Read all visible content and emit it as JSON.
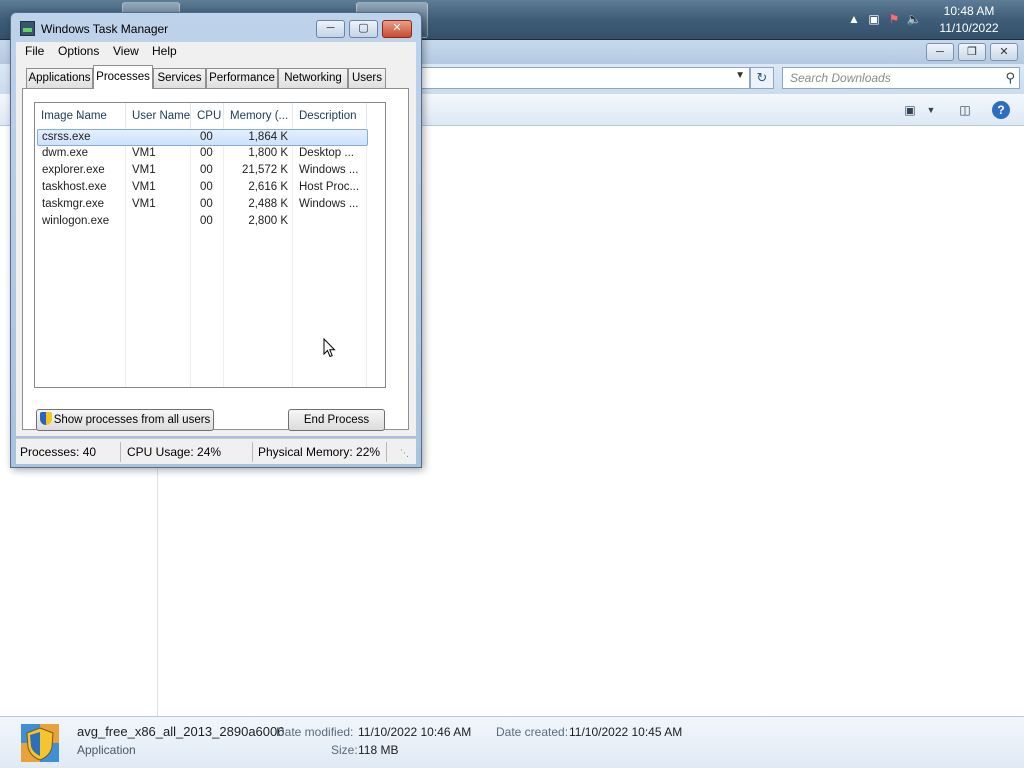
{
  "taskbar": {
    "clock_time": "10:48 AM",
    "clock_date": "11/10/2022",
    "tray_icons": [
      "show-hidden-icons-arrow",
      "network-icon",
      "action-center-icon",
      "volume-icon"
    ]
  },
  "explorer": {
    "search_placeholder": "Search Downloads",
    "caption_buttons": [
      "minimize",
      "maximize",
      "close"
    ],
    "details": {
      "file_name": "avg_free_x86_all_2013_2890a6006",
      "file_type": "Application",
      "date_modified_label": "Date modified:",
      "date_modified": "11/10/2022 10:46 AM",
      "date_created_label": "Date created:",
      "date_created": "11/10/2022 10:45 AM",
      "size_label": "Size:",
      "size": "118 MB"
    }
  },
  "taskmanager": {
    "title": "Windows Task Manager",
    "menu": [
      "File",
      "Options",
      "View",
      "Help"
    ],
    "tabs": [
      "Applications",
      "Processes",
      "Services",
      "Performance",
      "Networking",
      "Users"
    ],
    "active_tab": "Processes",
    "columns": [
      "Image Name",
      "User Name",
      "CPU",
      "Memory (...",
      "Description"
    ],
    "rows": [
      {
        "image": "csrss.exe",
        "user": "",
        "cpu": "00",
        "memory": "1,864 K",
        "desc": "",
        "selected": true
      },
      {
        "image": "dwm.exe",
        "user": "VM1",
        "cpu": "00",
        "memory": "1,800 K",
        "desc": "Desktop ..."
      },
      {
        "image": "explorer.exe",
        "user": "VM1",
        "cpu": "00",
        "memory": "21,572 K",
        "desc": "Windows ..."
      },
      {
        "image": "taskhost.exe",
        "user": "VM1",
        "cpu": "00",
        "memory": "2,616 K",
        "desc": "Host Proc..."
      },
      {
        "image": "taskmgr.exe",
        "user": "VM1",
        "cpu": "00",
        "memory": "2,488 K",
        "desc": "Windows ..."
      },
      {
        "image": "winlogon.exe",
        "user": "",
        "cpu": "00",
        "memory": "2,800 K",
        "desc": ""
      }
    ],
    "show_all_button": "Show processes from all users",
    "end_process_button": "End Process",
    "status": {
      "processes": "Processes: 40",
      "cpu": "CPU Usage: 24%",
      "memory": "Physical Memory: 22%"
    }
  }
}
